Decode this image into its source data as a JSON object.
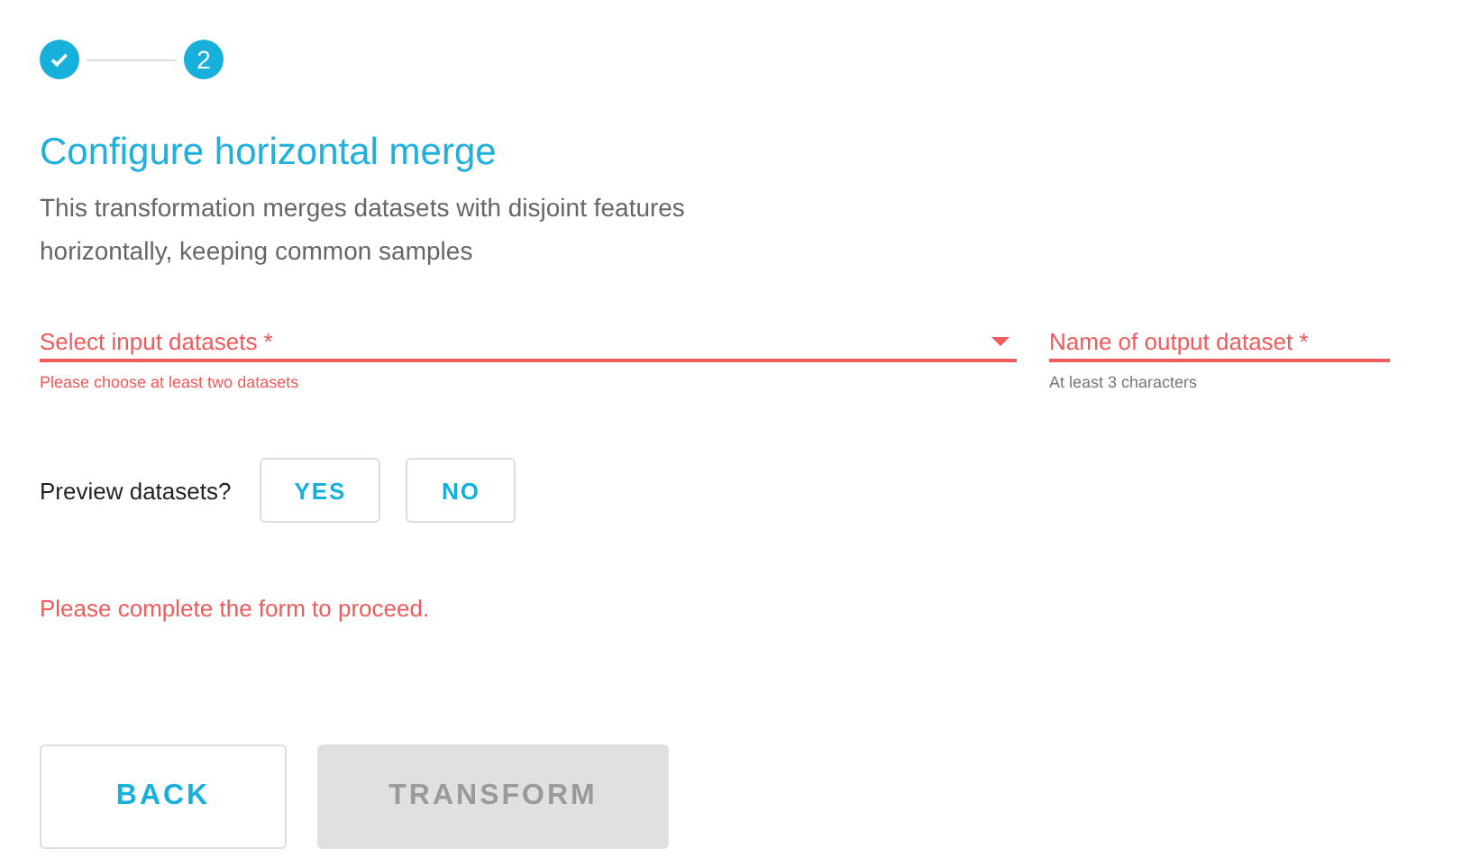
{
  "stepper": [
    {
      "done": true
    },
    {
      "label": "2",
      "done": false
    }
  ],
  "title": "Configure horizontal merge",
  "description": "This transformation merges datasets with disjoint features horizontally, keeping common samples",
  "fields": [
    {
      "kind": "select",
      "placeholder": "Select input datasets *",
      "invalid": true,
      "helper": "Please choose at least two datasets",
      "helper_error": true
    },
    {
      "kind": "text",
      "placeholder": "Name of output dataset *",
      "invalid": true,
      "helper": "At least 3 characters",
      "helper_error": false
    }
  ],
  "preview": {
    "label": "Preview datasets?",
    "options": [
      {
        "label": "YES",
        "selected": false
      },
      {
        "label": "NO",
        "selected": false
      }
    ]
  },
  "message": "Please complete the form to proceed.",
  "buttons": [
    {
      "label": "BACK",
      "disabled": false
    },
    {
      "label": "TRANSFORM",
      "disabled": true
    }
  ]
}
